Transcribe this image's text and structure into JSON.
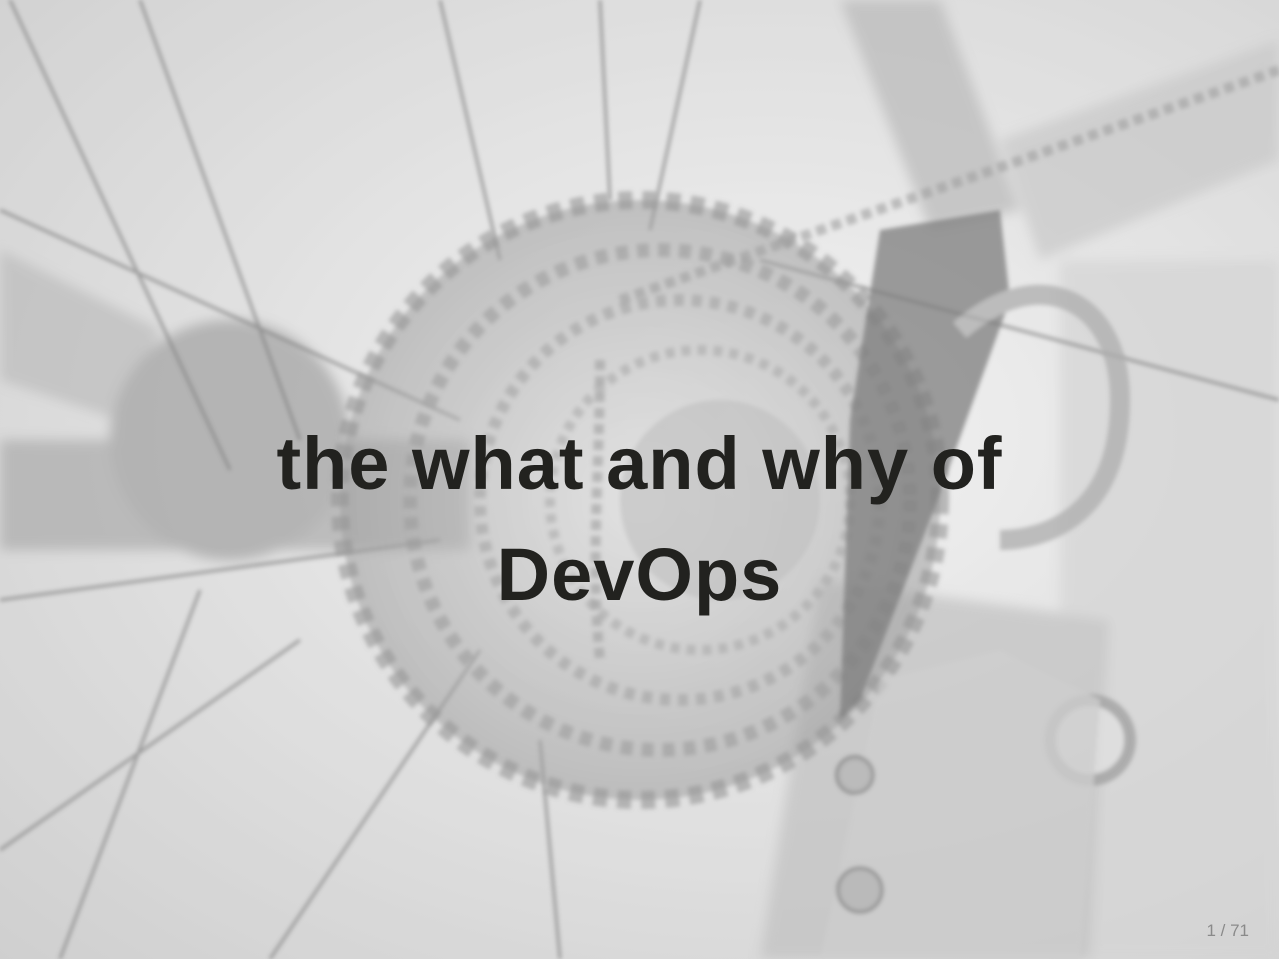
{
  "slide": {
    "title_line_1": "the what and why of",
    "title_line_2": "DevOps",
    "page_counter": "1 / 71"
  },
  "background": {
    "image": "bicycle-rear-cassette-photo",
    "tone": "desaturated light grey"
  },
  "colors": {
    "title_text": "#22221f",
    "counter_text": "#8a8a8a"
  }
}
